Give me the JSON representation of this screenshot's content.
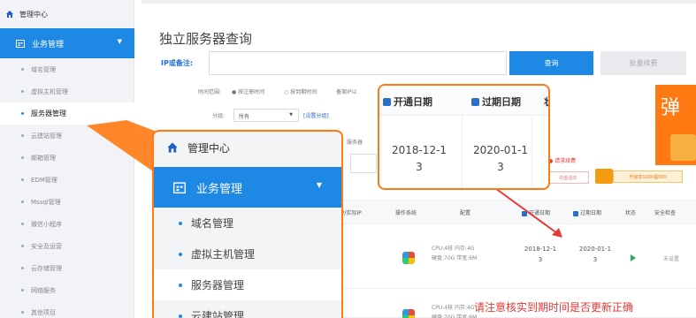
{
  "sidebar": {
    "home": "管理中心",
    "section": "业务管理",
    "items": [
      "域名管理",
      "虚拟主机管理",
      "服务器管理",
      "云建站管理",
      "邮箱管理",
      "EDM管理",
      "Mssql管理",
      "微信小程序",
      "安全及运营",
      "云存储管理",
      "网络服务",
      "其他项目"
    ]
  },
  "page": {
    "title": "独立服务器查询",
    "ip_label": "IP或备注:",
    "query_button": "查询",
    "batch_button": "批量续费"
  },
  "filters": {
    "time_range_label": "时间范围:",
    "opt1": "按注册时间",
    "opt2": "按到期时间",
    "opt3": "备案IP以",
    "category_label": "分组:",
    "category_value": "所有",
    "custom_link": "[设置分组]",
    "mid_label": "服务器"
  },
  "promo": {
    "glyph": "弹",
    "red_text": "● 请求续费",
    "tag1": "充值活动",
    "tag3": "升级享1000福500"
  },
  "table": {
    "headers": {
      "ip": "IP/实际IP",
      "os": "操作系统",
      "config": "配置",
      "open": "开通日期",
      "expire": "过期日期",
      "status": "状态",
      "safety": "安全检查"
    },
    "rows": [
      {
        "config": "CPU:4核 内存:4G\n硬盘:70G 带宽:6M",
        "open": "2018-12-1\n3",
        "expire": "2020-01-1\n3",
        "safety": "未设置"
      },
      {
        "config": "CPU:4核 内存:4G\n硬盘:70G 带宽:6M"
      }
    ]
  },
  "zoom": {
    "open_header": "开通日期",
    "expire_header": "过期日期",
    "extra_header": "状",
    "open_value": "2018-12-1\n3",
    "expire_value": "2020-01-1\n3"
  },
  "note": "请注意核实到期时间是否更新正确",
  "colors": {
    "accent": "#1e88e5",
    "callout": "#ff7a12",
    "note": "#e53935"
  }
}
